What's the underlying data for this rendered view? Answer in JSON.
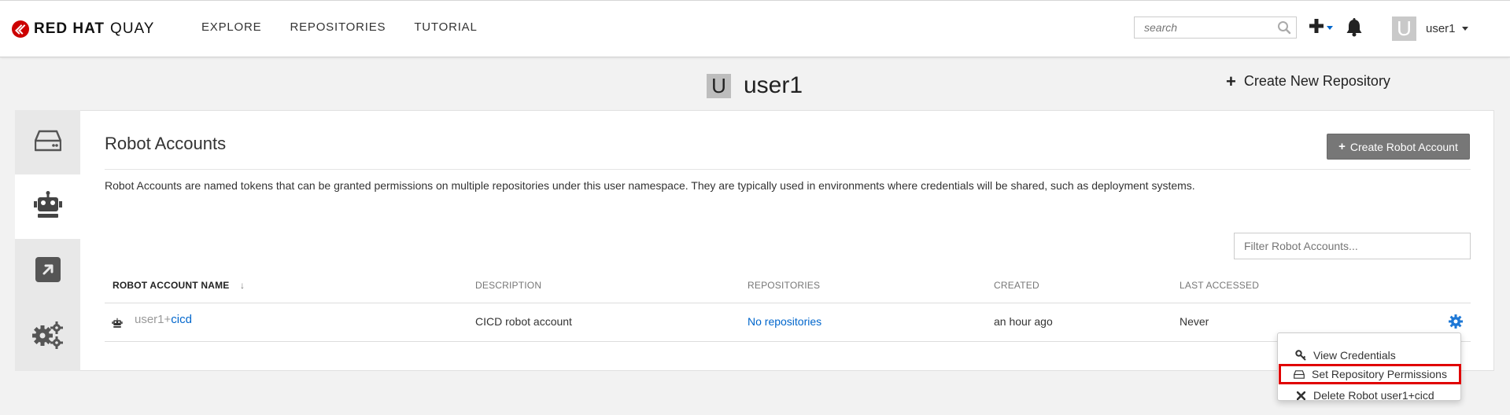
{
  "brand": {
    "name_bold": "RED HAT",
    "name_light": "QUAY"
  },
  "nav": {
    "items": [
      "EXPLORE",
      "REPOSITORIES",
      "TUTORIAL"
    ]
  },
  "search": {
    "placeholder": "search"
  },
  "user": {
    "avatar_letter": "U",
    "name": "user1"
  },
  "page": {
    "avatar_letter": "U",
    "title": "user1",
    "create_repo_label": "Create New Repository"
  },
  "robots": {
    "title": "Robot Accounts",
    "create_button_label": "Create Robot Account",
    "description": "Robot Accounts are named tokens that can be granted permissions on multiple repositories under this user namespace. They are typically used in environments where credentials will be shared, such as deployment systems.",
    "filter_placeholder": "Filter Robot Accounts...",
    "columns": [
      "ROBOT ACCOUNT NAME",
      "DESCRIPTION",
      "REPOSITORIES",
      "CREATED",
      "LAST ACCESSED"
    ],
    "sort_indicator": "↓",
    "rows": [
      {
        "name_prefix": "user1+",
        "name_suffix": "cicd",
        "description": "CICD robot account",
        "repositories": "No repositories",
        "created": "an hour ago",
        "last_accessed": "Never"
      }
    ]
  },
  "menu": {
    "items": [
      {
        "label": "View Credentials",
        "icon": "key-icon"
      },
      {
        "label": "Set Repository Permissions",
        "icon": "hdd-icon",
        "highlighted": true
      },
      {
        "label": "Delete Robot user1+cicd",
        "icon": "times-icon"
      }
    ]
  },
  "colors": {
    "brand_red": "#cc0000",
    "link_blue": "#0066cc",
    "highlight_red": "#e00000"
  }
}
